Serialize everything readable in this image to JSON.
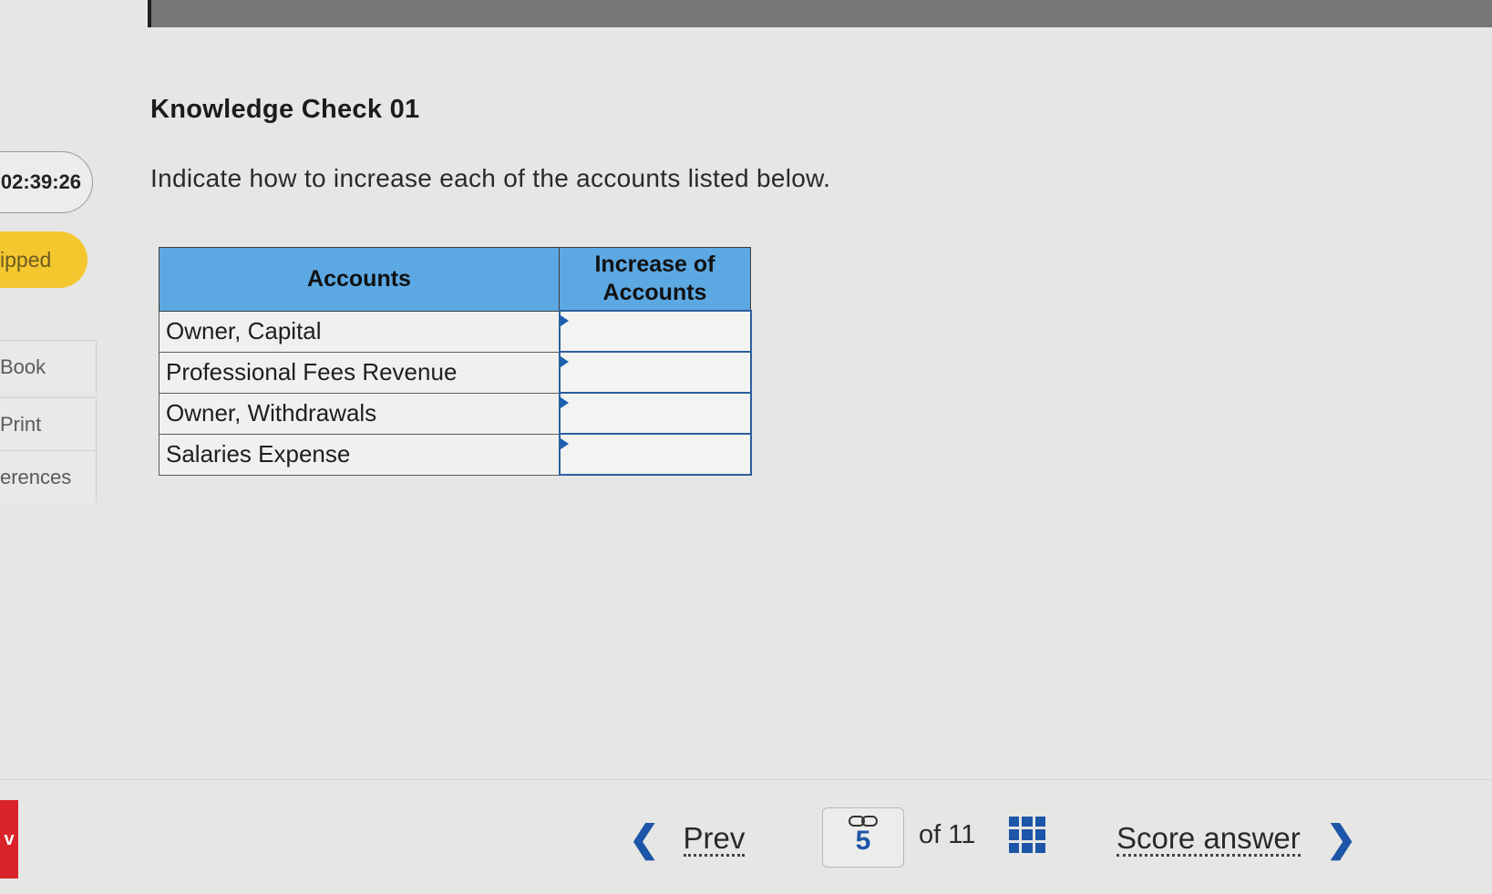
{
  "header": {
    "title": "Knowledge Check 01"
  },
  "question": {
    "instruction": "Indicate how to increase each of the accounts listed below."
  },
  "sidebar": {
    "timer": "02:39:26",
    "status_badge": "ipped",
    "links": [
      "Book",
      "Print",
      "erences"
    ],
    "red_tab_label": "v"
  },
  "table": {
    "headers": [
      "Accounts",
      "Increase of Accounts"
    ],
    "rows": [
      {
        "account": "Owner, Capital",
        "increase": ""
      },
      {
        "account": "Professional Fees Revenue",
        "increase": ""
      },
      {
        "account": "Owner, Withdrawals",
        "increase": ""
      },
      {
        "account": "Salaries Expense",
        "increase": ""
      }
    ]
  },
  "footer": {
    "prev_label": "Prev",
    "current_page": "5",
    "of_label": "of 11",
    "score_label": "Score answer"
  },
  "icons": {
    "prev": "chevron-left-icon",
    "next": "chevron-right-icon",
    "link": "link-icon",
    "grid": "grid-icon"
  },
  "colors": {
    "header_blue": "#5ca8e3",
    "accent_blue": "#1d56a8",
    "badge_yellow": "#f4c72f",
    "red_tab": "#d8232a"
  }
}
